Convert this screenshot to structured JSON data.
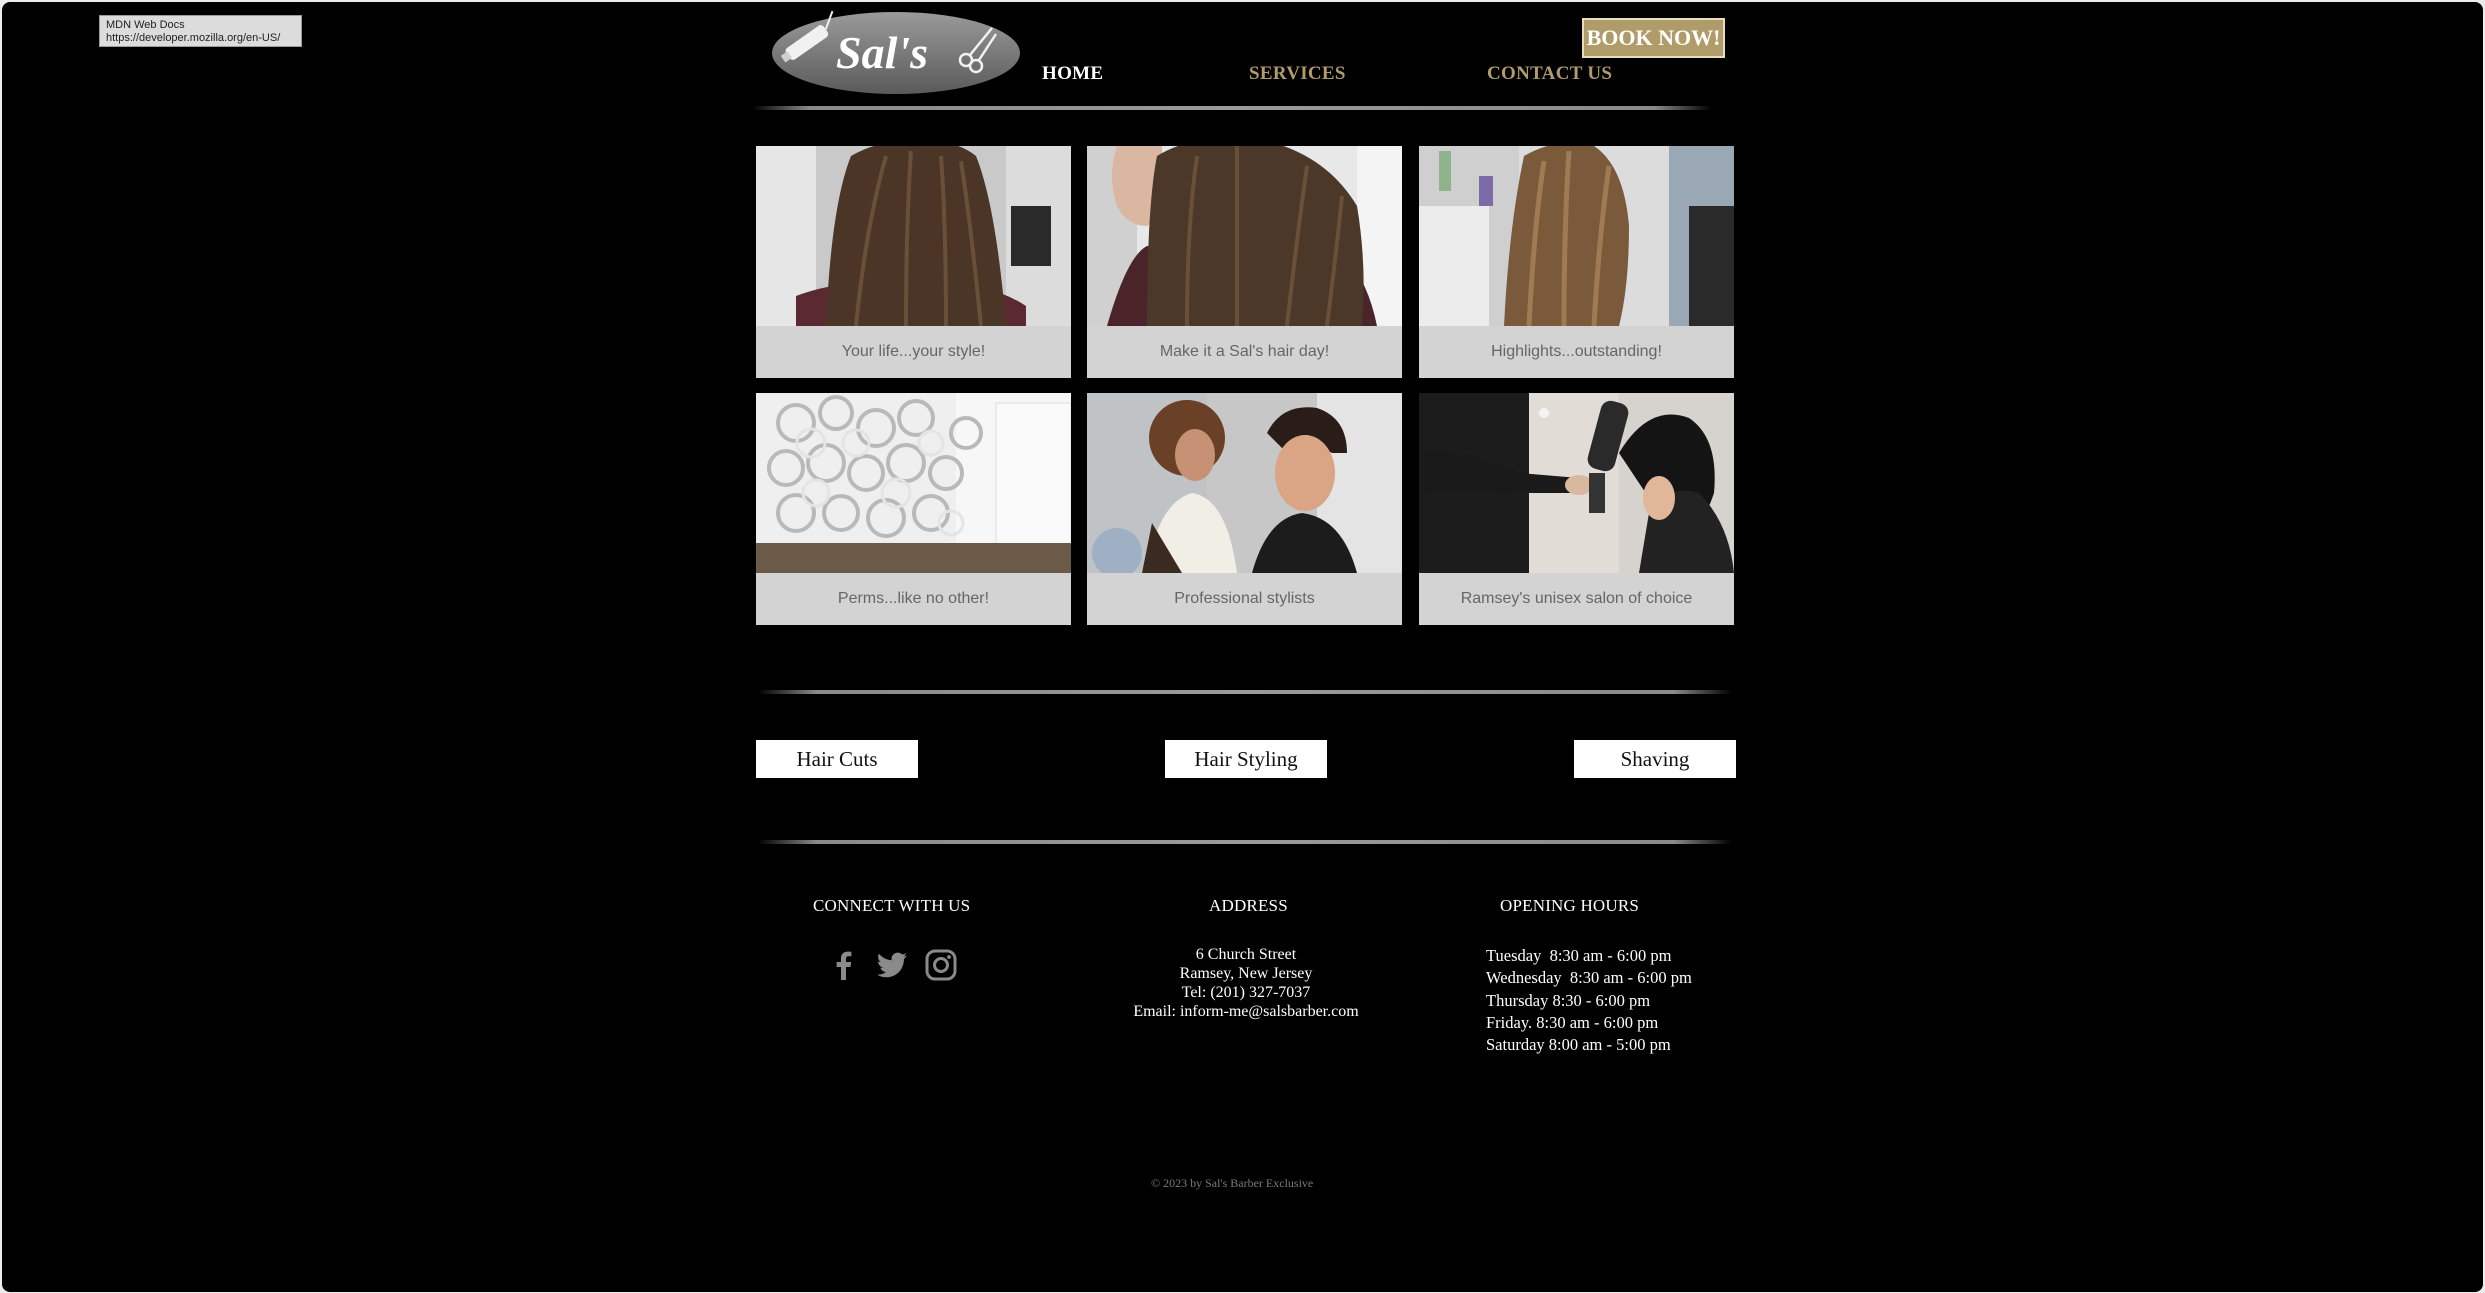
{
  "tooltip": {
    "title": "MDN Web Docs",
    "url": "https://developer.mozilla.org/en-US/"
  },
  "header": {
    "logo_text": "Sal's",
    "nav": [
      {
        "label": "HOME"
      },
      {
        "label": "SERVICES"
      },
      {
        "label": "CONTACT US"
      }
    ],
    "book_label": "BOOK NOW!"
  },
  "gallery": [
    {
      "caption": "Your life...your style!"
    },
    {
      "caption": "Make it a Sal's hair day!"
    },
    {
      "caption": "Highlights...outstanding!"
    },
    {
      "caption": "Perms...like no other!"
    },
    {
      "caption": "Professional stylists"
    },
    {
      "caption": "Ramsey's unisex salon of choice"
    }
  ],
  "services": [
    {
      "label": "Hair Cuts"
    },
    {
      "label": "Hair Styling"
    },
    {
      "label": "Shaving"
    }
  ],
  "footer": {
    "connect_heading": "CONNECT WITH US",
    "social_icons": [
      "facebook-icon",
      "twitter-icon",
      "instagram-icon"
    ],
    "address_heading": "ADDRESS",
    "address_lines": [
      "6 Church Street",
      "Ramsey, New Jersey",
      "Tel: (201) 327-7037",
      "Email: inform-me@salsbarber.com"
    ],
    "hours_heading": "OPENING HOURS",
    "hours_lines": [
      "Tuesday  8:30 am - 6:00 pm",
      "Wednesday  8:30 am - 6:00 pm",
      "Thursday 8:30 - 6:00 pm",
      "Friday. 8:30 am - 6:00 pm",
      "Saturday 8:00 am - 5:00 pm"
    ],
    "copyright": "© 2023 by Sal's Barber Exclusive"
  },
  "colors": {
    "background": "#000000",
    "accent_gold": "#b09c6a",
    "caption_bg": "#d3d3d3",
    "caption_text": "#666666"
  }
}
